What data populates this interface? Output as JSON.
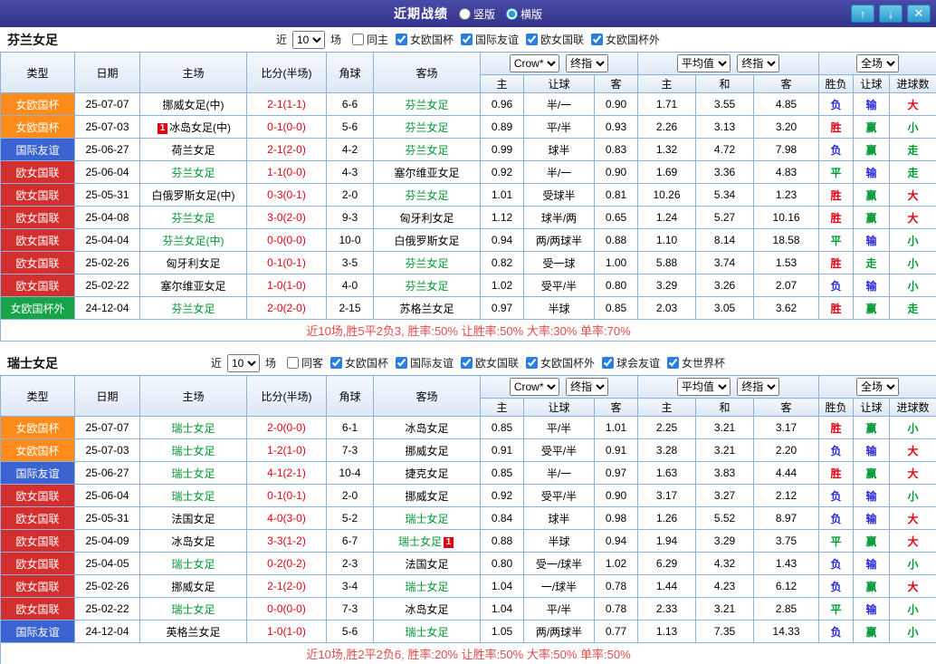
{
  "topbar": {
    "title": "近期战绩",
    "vertical_label": "竖版",
    "vertical_selected": false,
    "horizontal_label": "横版",
    "horizontal_selected": true,
    "up_icon": "↑",
    "down_icon": "↓",
    "close_icon": "✕"
  },
  "labels": {
    "recent_prefix": "近",
    "recent_suffix": "场"
  },
  "selects": {
    "bookmaker": "Crow*",
    "final": "终指",
    "average": "平均值",
    "fulltime": "全场"
  },
  "columns": {
    "type": "类型",
    "date": "日期",
    "home": "主场",
    "score": "比分(半场)",
    "corner": "角球",
    "away": "客场",
    "asia_home": "主",
    "asia_handicap": "让球",
    "asia_away": "客",
    "euro_home": "主",
    "euro_draw": "和",
    "euro_away": "客",
    "res_wdl": "胜负",
    "res_handicap": "让球",
    "res_goals": "进球数"
  },
  "colors": {
    "type_bg": {
      "女欧国杯": "#ff8c1a",
      "国际友谊": "#3b63d1",
      "欧女国联": "#d42f2f",
      "女欧国杯外": "#17a34a"
    },
    "result_text": {
      "胜": "#e60012",
      "平": "#009933",
      "负": "#2b2bd5",
      "赢": "#009933",
      "输": "#2b2bd5",
      "走": "#009933",
      "大": "#e60012",
      "小": "#009933"
    },
    "score": "#e60012",
    "team_highlight": "#009933",
    "summary": "#e14a4a",
    "accent": "#2d9cd0"
  },
  "sections": [
    {
      "team": "芬兰女足",
      "recent_count": "10",
      "filters": [
        {
          "label": "同主",
          "checked": false
        },
        {
          "label": "女欧国杯",
          "checked": true
        },
        {
          "label": "国际友谊",
          "checked": true
        },
        {
          "label": "欧女国联",
          "checked": true
        },
        {
          "label": "女欧国杯外",
          "checked": true
        }
      ],
      "rows": [
        {
          "type": "女欧国杯",
          "date": "25-07-07",
          "home": "挪威女足(中)",
          "score": "2-1(1-1)",
          "corner": "6-6",
          "away": "芬兰女足",
          "asia": [
            "0.96",
            "半/一",
            "0.90"
          ],
          "euro": [
            "1.71",
            "3.55",
            "4.85"
          ],
          "result": [
            "负",
            "输",
            "大"
          ]
        },
        {
          "type": "女欧国杯",
          "date": "25-07-03",
          "home": "冰岛女足(中)",
          "home_badge": {
            "text": "1",
            "side": "left"
          },
          "score": "0-1(0-0)",
          "corner": "5-6",
          "away": "芬兰女足",
          "asia": [
            "0.89",
            "平/半",
            "0.93"
          ],
          "euro": [
            "2.26",
            "3.13",
            "3.20"
          ],
          "result": [
            "胜",
            "赢",
            "小"
          ]
        },
        {
          "type": "国际友谊",
          "date": "25-06-27",
          "home": "荷兰女足",
          "score": "2-1(2-0)",
          "corner": "4-2",
          "away": "芬兰女足",
          "asia": [
            "0.99",
            "球半",
            "0.83"
          ],
          "euro": [
            "1.32",
            "4.72",
            "7.98"
          ],
          "result": [
            "负",
            "赢",
            "走"
          ]
        },
        {
          "type": "欧女国联",
          "date": "25-06-04",
          "home": "芬兰女足",
          "score": "1-1(0-0)",
          "corner": "4-3",
          "away": "塞尔维亚女足",
          "asia": [
            "0.92",
            "半/一",
            "0.90"
          ],
          "euro": [
            "1.69",
            "3.36",
            "4.83"
          ],
          "result": [
            "平",
            "输",
            "走"
          ]
        },
        {
          "type": "欧女国联",
          "date": "25-05-31",
          "home": "白俄罗斯女足(中)",
          "score": "0-3(0-1)",
          "corner": "2-0",
          "away": "芬兰女足",
          "asia": [
            "1.01",
            "受球半",
            "0.81"
          ],
          "euro": [
            "10.26",
            "5.34",
            "1.23"
          ],
          "result": [
            "胜",
            "赢",
            "大"
          ]
        },
        {
          "type": "欧女国联",
          "date": "25-04-08",
          "home": "芬兰女足",
          "score": "3-0(2-0)",
          "corner": "9-3",
          "away": "匈牙利女足",
          "asia": [
            "1.12",
            "球半/两",
            "0.65"
          ],
          "euro": [
            "1.24",
            "5.27",
            "10.16"
          ],
          "result": [
            "胜",
            "赢",
            "大"
          ]
        },
        {
          "type": "欧女国联",
          "date": "25-04-04",
          "home": "芬兰女足(中)",
          "score": "0-0(0-0)",
          "corner": "10-0",
          "away": "白俄罗斯女足",
          "asia": [
            "0.94",
            "两/两球半",
            "0.88"
          ],
          "euro": [
            "1.10",
            "8.14",
            "18.58"
          ],
          "result": [
            "平",
            "输",
            "小"
          ]
        },
        {
          "type": "欧女国联",
          "date": "25-02-26",
          "home": "匈牙利女足",
          "score": "0-1(0-1)",
          "corner": "3-5",
          "away": "芬兰女足",
          "asia": [
            "0.82",
            "受一球",
            "1.00"
          ],
          "euro": [
            "5.88",
            "3.74",
            "1.53"
          ],
          "result": [
            "胜",
            "走",
            "小"
          ]
        },
        {
          "type": "欧女国联",
          "date": "25-02-22",
          "home": "塞尔维亚女足",
          "score": "1-0(1-0)",
          "corner": "4-0",
          "away": "芬兰女足",
          "asia": [
            "1.02",
            "受平/半",
            "0.80"
          ],
          "euro": [
            "3.29",
            "3.26",
            "2.07"
          ],
          "result": [
            "负",
            "输",
            "小"
          ]
        },
        {
          "type": "女欧国杯外",
          "date": "24-12-04",
          "home": "芬兰女足",
          "score": "2-0(2-0)",
          "corner": "2-15",
          "away": "苏格兰女足",
          "asia": [
            "0.97",
            "半球",
            "0.85"
          ],
          "euro": [
            "2.03",
            "3.05",
            "3.62"
          ],
          "result": [
            "胜",
            "赢",
            "走"
          ]
        }
      ],
      "summary": "近10场,胜5平2负3, 胜率:50% 让胜率:50% 大率:30% 单率:70%"
    },
    {
      "team": "瑞士女足",
      "recent_count": "10",
      "filters": [
        {
          "label": "同客",
          "checked": false
        },
        {
          "label": "女欧国杯",
          "checked": true
        },
        {
          "label": "国际友谊",
          "checked": true
        },
        {
          "label": "欧女国联",
          "checked": true
        },
        {
          "label": "女欧国杯外",
          "checked": true
        },
        {
          "label": "球会友谊",
          "checked": true
        },
        {
          "label": "女世界杯",
          "checked": true
        }
      ],
      "rows": [
        {
          "type": "女欧国杯",
          "date": "25-07-07",
          "home": "瑞士女足",
          "score": "2-0(0-0)",
          "corner": "6-1",
          "away": "冰岛女足",
          "asia": [
            "0.85",
            "平/半",
            "1.01"
          ],
          "euro": [
            "2.25",
            "3.21",
            "3.17"
          ],
          "result": [
            "胜",
            "赢",
            "小"
          ]
        },
        {
          "type": "女欧国杯",
          "date": "25-07-03",
          "home": "瑞士女足",
          "score": "1-2(1-0)",
          "corner": "7-3",
          "away": "挪威女足",
          "asia": [
            "0.91",
            "受平/半",
            "0.91"
          ],
          "euro": [
            "3.28",
            "3.21",
            "2.20"
          ],
          "result": [
            "负",
            "输",
            "大"
          ]
        },
        {
          "type": "国际友谊",
          "date": "25-06-27",
          "home": "瑞士女足",
          "score": "4-1(2-1)",
          "corner": "10-4",
          "away": "捷克女足",
          "asia": [
            "0.85",
            "半/一",
            "0.97"
          ],
          "euro": [
            "1.63",
            "3.83",
            "4.44"
          ],
          "result": [
            "胜",
            "赢",
            "大"
          ]
        },
        {
          "type": "欧女国联",
          "date": "25-06-04",
          "home": "瑞士女足",
          "score": "0-1(0-1)",
          "corner": "2-0",
          "away": "挪威女足",
          "asia": [
            "0.92",
            "受平/半",
            "0.90"
          ],
          "euro": [
            "3.17",
            "3.27",
            "2.12"
          ],
          "result": [
            "负",
            "输",
            "小"
          ]
        },
        {
          "type": "欧女国联",
          "date": "25-05-31",
          "home": "法国女足",
          "score": "4-0(3-0)",
          "corner": "5-2",
          "away": "瑞士女足",
          "asia": [
            "0.84",
            "球半",
            "0.98"
          ],
          "euro": [
            "1.26",
            "5.52",
            "8.97"
          ],
          "result": [
            "负",
            "输",
            "大"
          ]
        },
        {
          "type": "欧女国联",
          "date": "25-04-09",
          "home": "冰岛女足",
          "score": "3-3(1-2)",
          "corner": "6-7",
          "away": "瑞士女足",
          "away_badge": {
            "text": "1",
            "side": "right"
          },
          "asia": [
            "0.88",
            "半球",
            "0.94"
          ],
          "euro": [
            "1.94",
            "3.29",
            "3.75"
          ],
          "result": [
            "平",
            "赢",
            "大"
          ]
        },
        {
          "type": "欧女国联",
          "date": "25-04-05",
          "home": "瑞士女足",
          "score": "0-2(0-2)",
          "corner": "2-3",
          "away": "法国女足",
          "asia": [
            "0.80",
            "受一/球半",
            "1.02"
          ],
          "euro": [
            "6.29",
            "4.32",
            "1.43"
          ],
          "result": [
            "负",
            "输",
            "小"
          ]
        },
        {
          "type": "欧女国联",
          "date": "25-02-26",
          "home": "挪威女足",
          "score": "2-1(2-0)",
          "corner": "3-4",
          "away": "瑞士女足",
          "asia": [
            "1.04",
            "一/球半",
            "0.78"
          ],
          "euro": [
            "1.44",
            "4.23",
            "6.12"
          ],
          "result": [
            "负",
            "赢",
            "大"
          ]
        },
        {
          "type": "欧女国联",
          "date": "25-02-22",
          "home": "瑞士女足",
          "score": "0-0(0-0)",
          "corner": "7-3",
          "away": "冰岛女足",
          "asia": [
            "1.04",
            "平/半",
            "0.78"
          ],
          "euro": [
            "2.33",
            "3.21",
            "2.85"
          ],
          "result": [
            "平",
            "输",
            "小"
          ]
        },
        {
          "type": "国际友谊",
          "date": "24-12-04",
          "home": "英格兰女足",
          "score": "1-0(1-0)",
          "corner": "5-6",
          "away": "瑞士女足",
          "asia": [
            "1.05",
            "两/两球半",
            "0.77"
          ],
          "euro": [
            "1.13",
            "7.35",
            "14.33"
          ],
          "result": [
            "负",
            "赢",
            "小"
          ]
        }
      ],
      "summary": "近10场,胜2平2负6, 胜率:20% 让胜率:50% 大率:50% 单率:50%"
    }
  ]
}
